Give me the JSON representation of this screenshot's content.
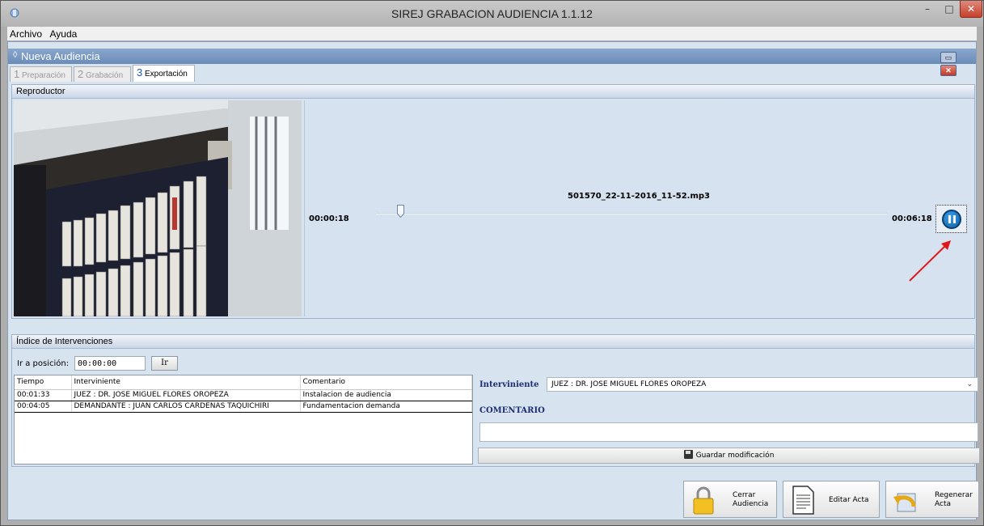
{
  "window": {
    "title": "SIREJ GRABACION AUDIENCIA 1.1.12",
    "minimize": "–",
    "maximize": "□",
    "close": "✕"
  },
  "menu": {
    "items": [
      "Archivo",
      "Ayuda"
    ]
  },
  "child": {
    "title": "Nueva Audiencia",
    "min": "▭",
    "close": "✕"
  },
  "tabs": [
    {
      "num": "1",
      "label": "Preparación",
      "active": false
    },
    {
      "num": "2",
      "label": "Grabación",
      "active": false
    },
    {
      "num": "3",
      "label": "Exportación",
      "active": true
    }
  ],
  "player": {
    "header": "Reproductor",
    "filename": "501570_22-11-2016_11-52.mp3",
    "current_time": "00:00:18",
    "total_time": "00:06:18",
    "progress": 0.048,
    "play_state": "pause-icon"
  },
  "index": {
    "header": "Índice de Intervenciones",
    "goto_label": "Ir a posición:",
    "goto_value": "00:00:00",
    "goto_button": "Ir",
    "columns": [
      "Tiempo",
      "Interviniente",
      "Comentario"
    ],
    "rows": [
      [
        "00:01:33",
        "JUEZ : DR. JOSE MIGUEL FLORES OROPEZA",
        "Instalacion de audiencia"
      ],
      [
        "00:04:05",
        "DEMANDANTE : JUAN CARLOS CARDENAS TAQUICHIRI",
        "Fundamentacion demanda"
      ]
    ],
    "interviniente_label": "Interviniente",
    "interviniente_value": "JUEZ : DR. JOSE MIGUEL FLORES OROPEZA",
    "comentario_label": "COMENTARIO",
    "comentario_value": "",
    "save_button": "Guardar modificación"
  },
  "actions": {
    "close_line1": "Cerrar",
    "close_line2": "Audiencia",
    "edit": "Editar Acta",
    "regen_line1": "Regenerar",
    "regen_line2": "Acta"
  },
  "colors": {
    "accent": "#1a5aa8",
    "label_navy": "#1c2e6e",
    "annotation_arrow": "#e01818"
  }
}
